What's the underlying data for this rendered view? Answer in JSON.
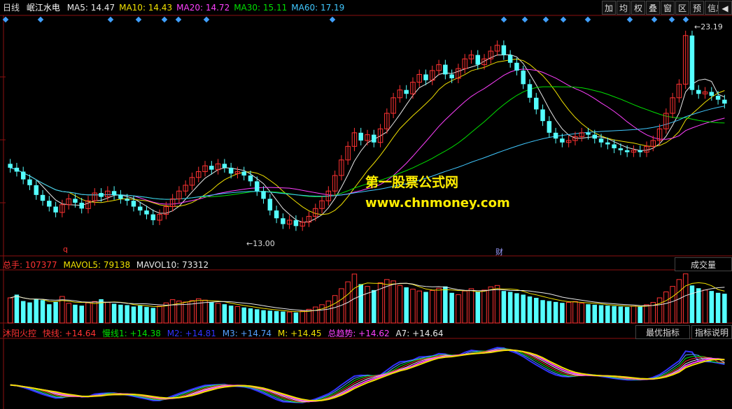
{
  "header": {
    "period": "日线",
    "stock_name": "岷江水电",
    "ma": [
      {
        "label": "MA5: 14.47",
        "color": "#e8e8e8"
      },
      {
        "label": "MA10: 14.43",
        "color": "#f0e000"
      },
      {
        "label": "MA20: 14.72",
        "color": "#ff40ff"
      },
      {
        "label": "MA30: 15.11",
        "color": "#00e000"
      },
      {
        "label": "MA60: 17.19",
        "color": "#40c8ff"
      }
    ],
    "toolbar": [
      "加",
      "均",
      "权",
      "叠",
      "窗",
      "区",
      "预",
      "信息"
    ]
  },
  "price_chart": {
    "high_label": "23.19",
    "low_label": "13.00",
    "marker_q": "q",
    "marker_cai": "财",
    "watermark_cn": "第一股票公式网",
    "watermark_url": "www.chnmoney.com"
  },
  "volume_panel": {
    "total": "总手: 107377",
    "mavol5": "MAVOL5: 79138",
    "mavol10": "MAVOL10: 73312",
    "button": "成交量"
  },
  "indicator_panel": {
    "name": "沐阳火控",
    "fast": "快线: +14.64",
    "slow1": "慢线1: +14.38",
    "m2": "M2: +14.81",
    "m3": "M3: +14.74",
    "m": "M: +14.45",
    "trend": "总趋势: +14.62",
    "a7": "A7: +14.64",
    "btn_optimal": "最优指标",
    "btn_help": "指标说明"
  },
  "colors": {
    "up": "#ff3232",
    "down": "#54ffff",
    "grid": "#8b1010"
  },
  "chart_data": {
    "type": "candlestick",
    "price_high": 23.19,
    "price_low": 13.0,
    "closes": [
      16.2,
      16.0,
      15.6,
      15.3,
      14.8,
      14.5,
      14.2,
      13.9,
      14.3,
      14.6,
      14.4,
      14.1,
      14.5,
      14.9,
      14.7,
      15.0,
      14.8,
      14.6,
      14.5,
      14.2,
      14.0,
      13.8,
      13.5,
      13.8,
      14.2,
      14.6,
      15.0,
      15.3,
      15.7,
      16.0,
      16.3,
      16.1,
      16.4,
      16.2,
      15.9,
      16.0,
      15.8,
      15.5,
      15.0,
      14.6,
      14.0,
      13.6,
      13.3,
      13.5,
      13.2,
      13.4,
      13.7,
      14.1,
      14.5,
      15.0,
      15.8,
      16.6,
      17.3,
      18.0,
      17.6,
      17.9,
      17.5,
      18.2,
      19.0,
      19.8,
      20.2,
      20.0,
      20.6,
      21.0,
      20.7,
      21.2,
      21.5,
      21.0,
      20.8,
      21.3,
      21.8,
      22.0,
      21.5,
      21.8,
      22.2,
      22.5,
      22.0,
      21.6,
      21.2,
      20.5,
      19.8,
      19.2,
      18.6,
      18.0,
      17.7,
      17.5,
      17.6,
      17.8,
      18.0,
      17.9,
      17.7,
      17.5,
      17.4,
      17.2,
      17.1,
      17.0,
      17.1,
      17.0,
      17.3,
      17.6,
      18.2,
      19.0,
      19.8,
      20.5,
      23.0,
      20.2,
      20.0,
      20.1,
      19.9,
      19.7,
      19.5
    ],
    "volumes": [
      55000,
      62000,
      48000,
      45000,
      52000,
      50000,
      41000,
      46000,
      58000,
      43000,
      40000,
      38000,
      44000,
      47000,
      52000,
      45000,
      42000,
      40000,
      39000,
      36000,
      38000,
      35000,
      33000,
      37000,
      44000,
      51000,
      48000,
      46000,
      49000,
      53000,
      50000,
      45000,
      43000,
      41000,
      38000,
      36000,
      34000,
      32000,
      30000,
      28000,
      27000,
      26000,
      25000,
      24000,
      23000,
      26000,
      30000,
      35000,
      40000,
      48000,
      60000,
      75000,
      90000,
      107000,
      85000,
      80000,
      72000,
      88000,
      95000,
      92000,
      82000,
      78000,
      74000,
      70000,
      68000,
      71000,
      76000,
      80000,
      66000,
      62000,
      70000,
      75000,
      68000,
      72000,
      79000,
      82000,
      70000,
      68000,
      65000,
      62000,
      58000,
      55000,
      50000,
      48000,
      46000,
      44000,
      45000,
      47000,
      43000,
      41000,
      40000,
      39000,
      38000,
      37000,
      36000,
      35000,
      37000,
      36000,
      40000,
      45000,
      55000,
      68000,
      80000,
      95000,
      107377,
      82000,
      76000,
      72000,
      70000,
      66000,
      64000
    ]
  }
}
